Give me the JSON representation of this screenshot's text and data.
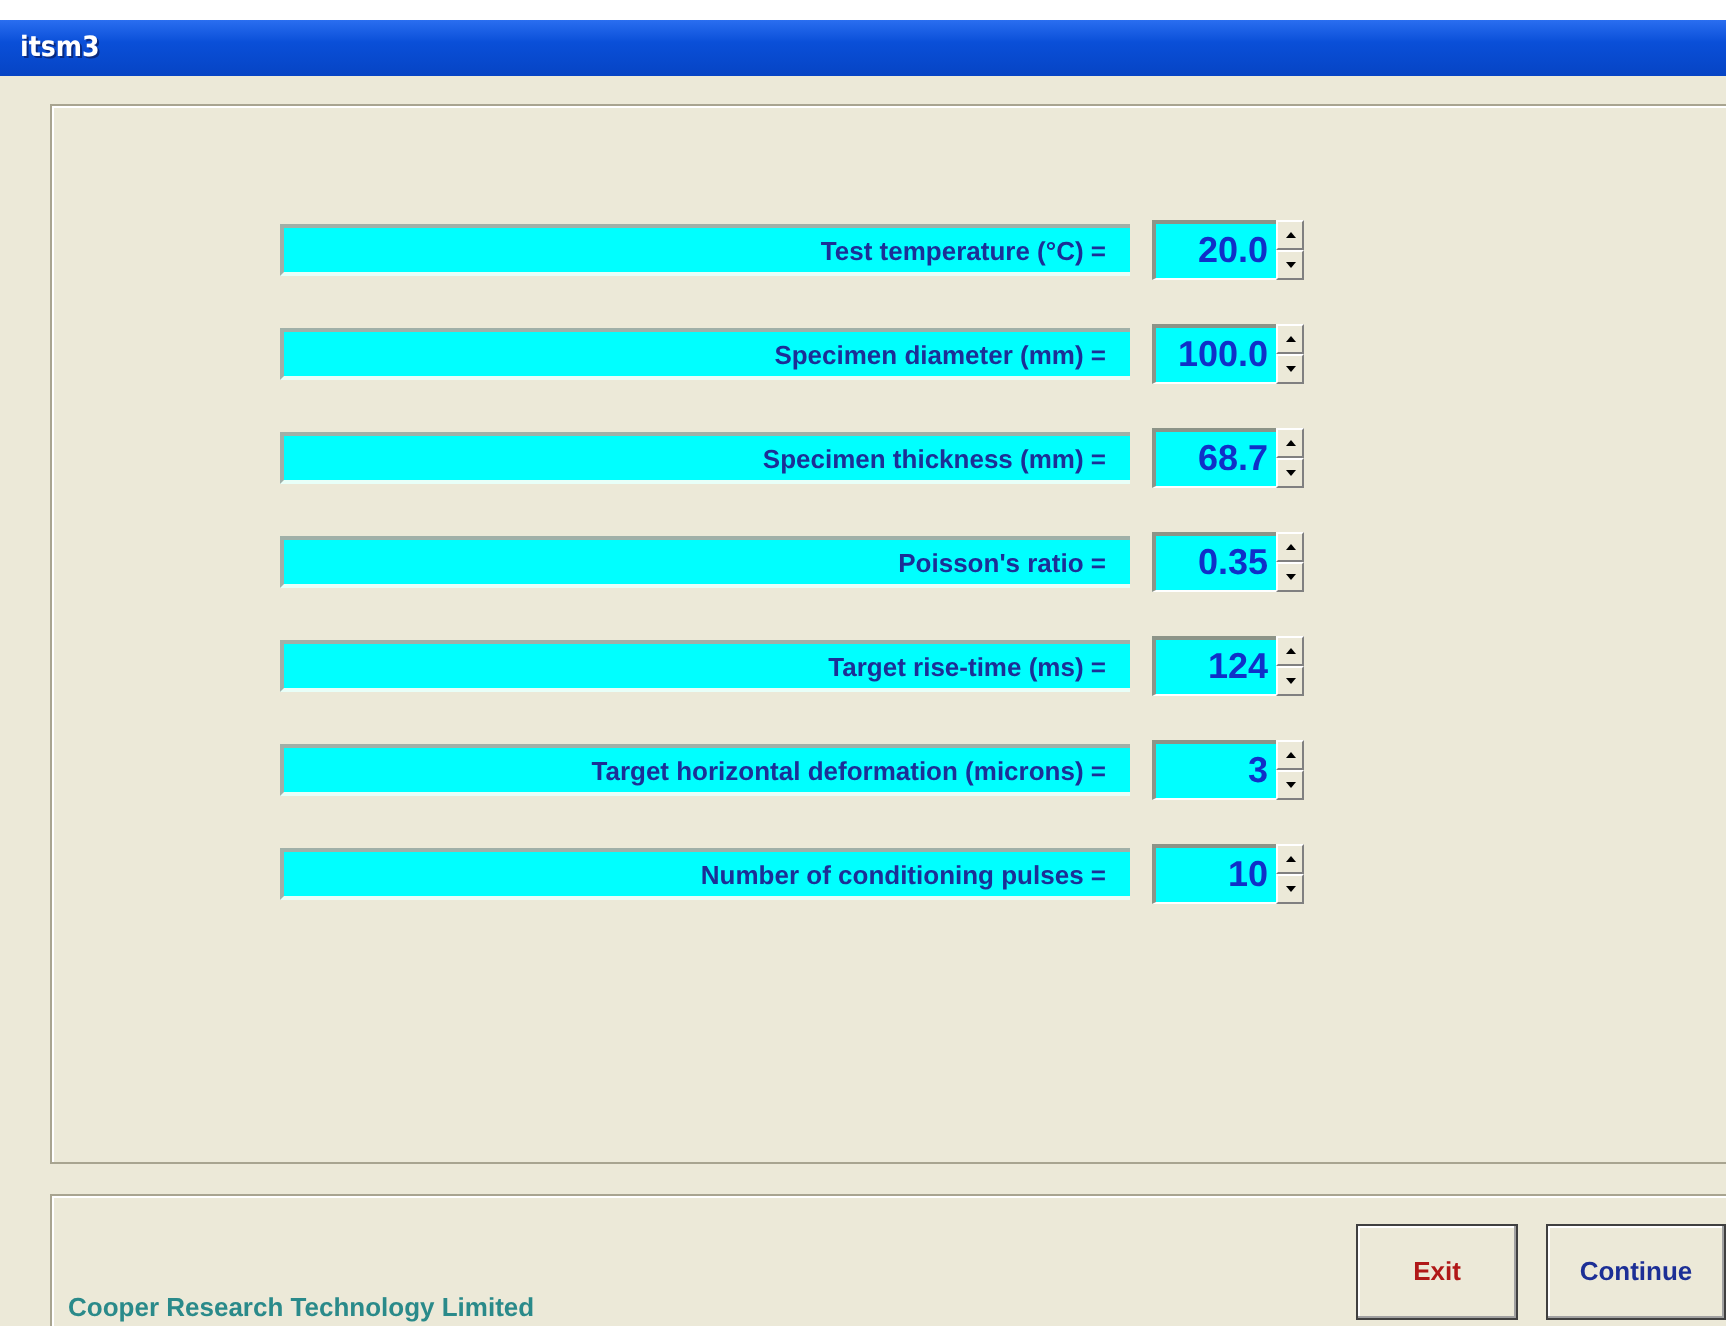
{
  "window": {
    "title": "itsm3"
  },
  "fields": [
    {
      "label": "Test temperature (°C) =",
      "value": "20.0"
    },
    {
      "label": "Specimen diameter (mm) =",
      "value": "100.0"
    },
    {
      "label": "Specimen thickness (mm) =",
      "value": "68.7"
    },
    {
      "label": "Poisson's ratio =",
      "value": "0.35"
    },
    {
      "label": "Target rise-time (ms) =",
      "value": "124"
    },
    {
      "label": "Target horizontal deformation (microns) =",
      "value": "3"
    },
    {
      "label": "Number of conditioning pulses =",
      "value": "10"
    }
  ],
  "footer": {
    "company": "Cooper Research Technology Limited",
    "buttons": [
      {
        "label": "Exit",
        "kind": "exit"
      },
      {
        "label": "Continue",
        "kind": "continue"
      }
    ]
  }
}
